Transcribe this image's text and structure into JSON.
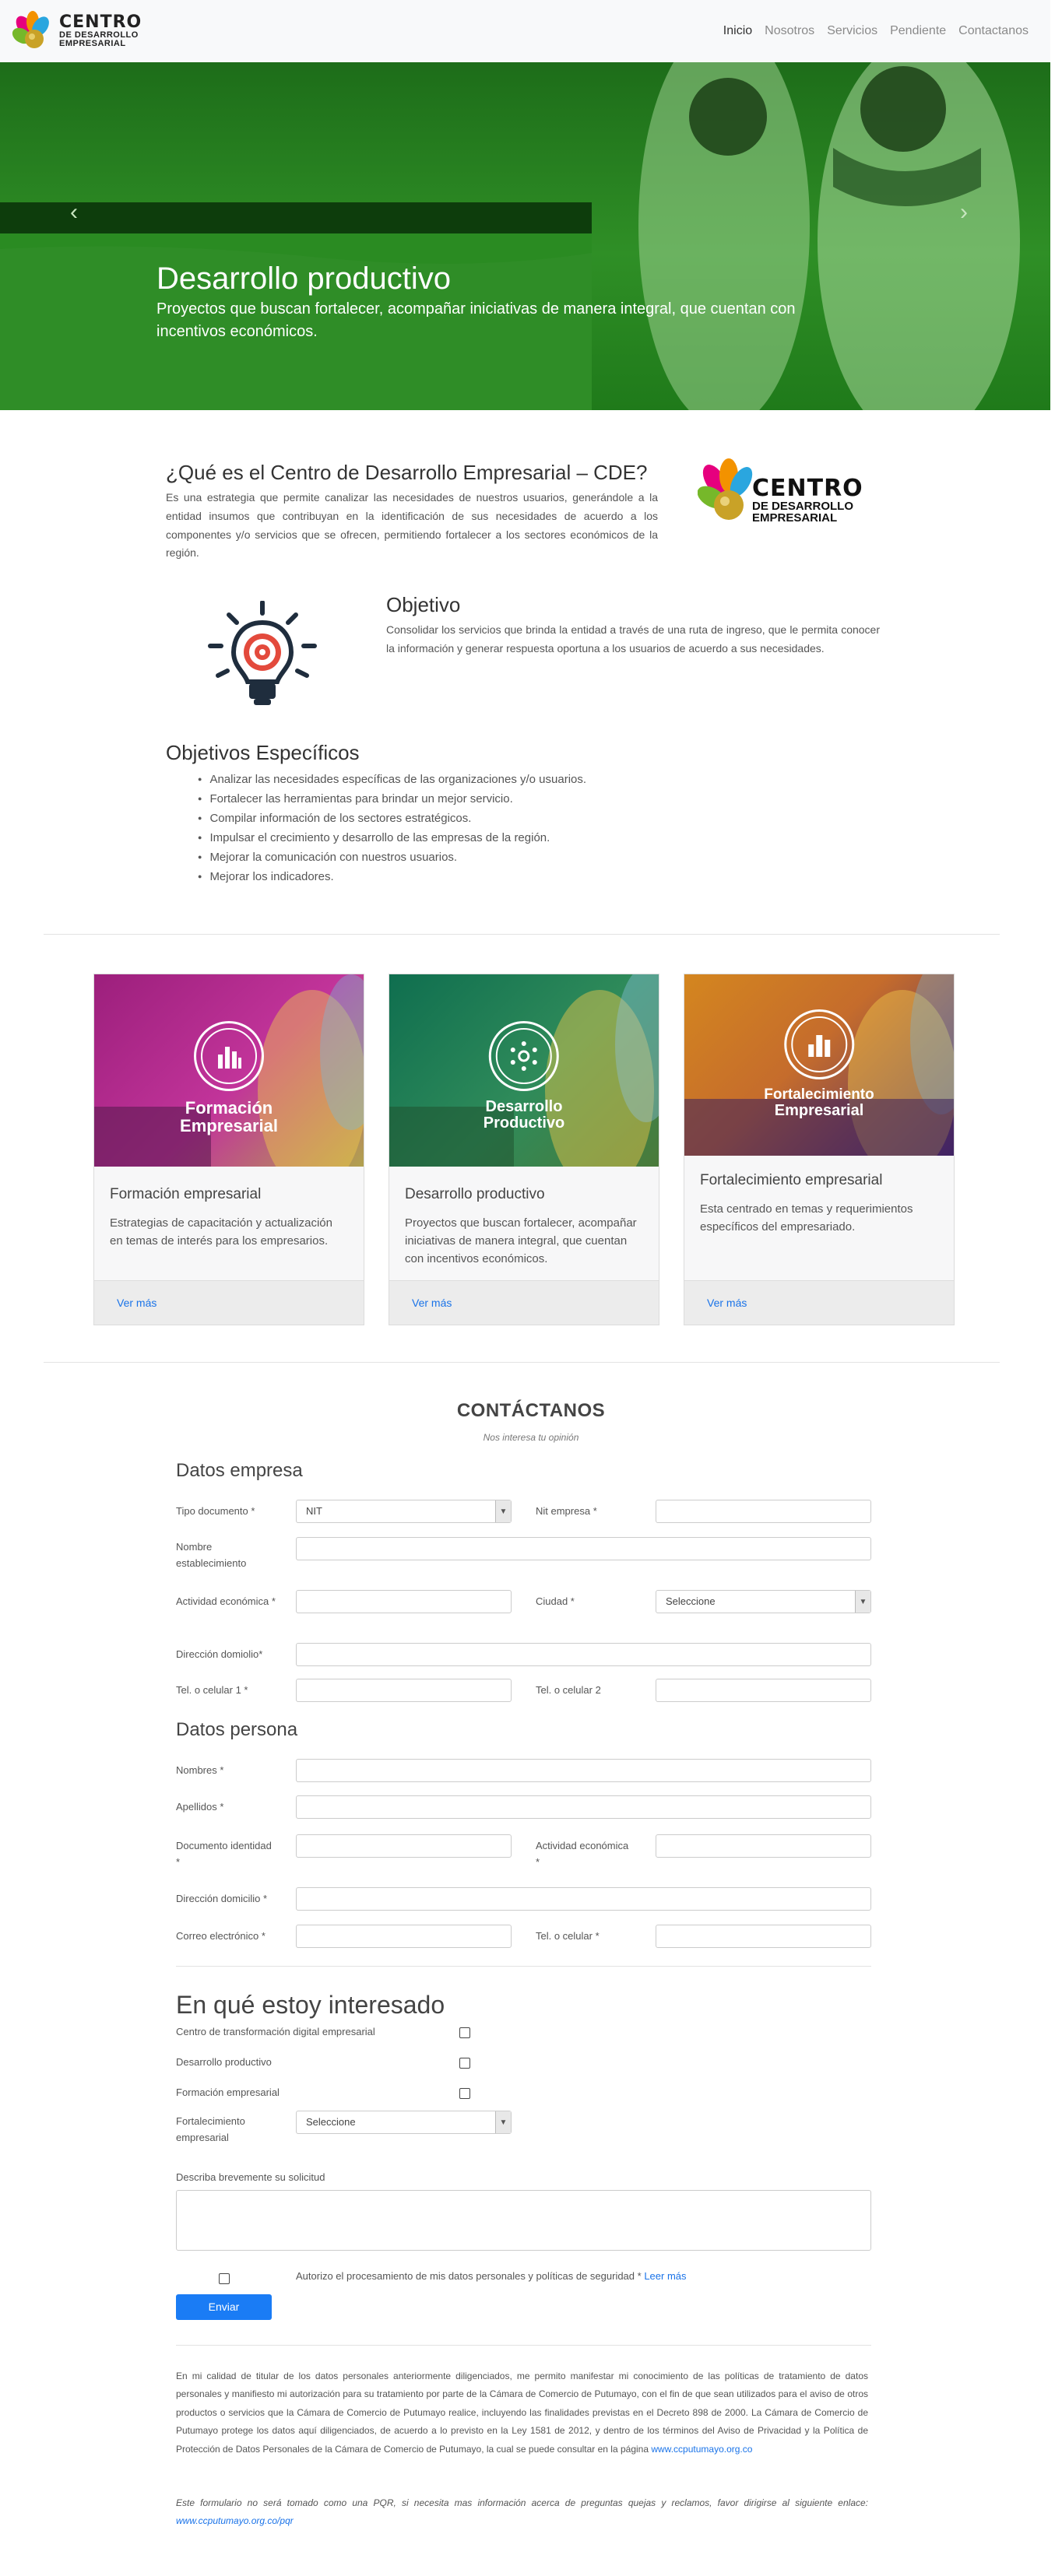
{
  "nav": {
    "logo": {
      "line1": "CENTRO",
      "line2": "DE DESARROLLO",
      "line3": "EMPRESARIAL"
    },
    "links": [
      "Inicio",
      "Nosotros",
      "Servicios",
      "Pendiente",
      "Contactanos"
    ]
  },
  "hero": {
    "title": "Desarrollo productivo",
    "text": "Proyectos que buscan fortalecer, acompañar iniciativas de manera integral, que cuentan con incentivos económicos.",
    "prev": "‹",
    "next": "›"
  },
  "about": {
    "title": "¿Qué es el Centro de Desarrollo Empresarial – CDE?",
    "text": "Es una estrategia que permite canalizar las necesidades de nuestros usuarios, generándole a la entidad insumos que contribuyan en la identificación de sus necesidades de acuerdo a los componentes y/o servicios que se ofrecen, permitiendo fortalecer a los sectores económicos de la región."
  },
  "objective": {
    "title": "Objetivo",
    "text": "Consolidar los servicios que brinda la entidad a través de una ruta de ingreso, que le permita conocer la información y generar respuesta oportuna a los usuarios de acuerdo a sus necesidades."
  },
  "specific": {
    "title": "Objetivos Específicos",
    "items": [
      "Analizar las necesidades específicas de las organizaciones y/o usuarios.",
      "Fortalecer las herramientas para brindar un mejor servicio.",
      "Compilar información de los sectores estratégicos.",
      "Impulsar el crecimiento y desarrollo de las empresas de la región.",
      "Mejorar la comunicación con nuestros usuarios.",
      "Mejorar los indicadores."
    ]
  },
  "cards": [
    {
      "badge1": "Formación",
      "badge2": "Empresarial",
      "title": "Formación empresarial",
      "text": "Estrategias de capacitación y actualización en temas de interés para los empresarios.",
      "link": "Ver más"
    },
    {
      "badge1": "Desarrollo",
      "badge2": "Productivo",
      "title": "Desarrollo productivo",
      "text": "Proyectos que buscan fortalecer, acompañar iniciativas de manera integral, que cuentan con incentivos económicos.",
      "link": "Ver más"
    },
    {
      "badge1": "Fortalecimiento",
      "badge2": "Empresarial",
      "title": "Fortalecimiento empresarial",
      "text": "Esta centrado en temas y requerimientos específicos del empresariado.",
      "link": "Ver más"
    }
  ],
  "contact": {
    "title": "CONTÁCTANOS",
    "subtitle": "Nos interesa tu opinión",
    "company_title": "Datos empresa",
    "tipo_doc_label": "Tipo documento *",
    "tipo_doc_value": "NIT",
    "nit_label": "Nit empresa *",
    "nombre_label": "Nombre establecimiento",
    "actividad_label": "Actividad económica *",
    "ciudad_label": "Ciudad *",
    "ciudad_value": "Seleccione",
    "direccion_label": "Dirección domiolio*",
    "tel1_label": "Tel. o celular 1 *",
    "tel2_label": "Tel. o celular 2",
    "person_title": "Datos persona",
    "nombres_label": "Nombres *",
    "apellidos_label": "Apellidos *",
    "documento_label": "Documento identidad *",
    "actividad2_label": "Actividad económica *",
    "direccion2_label": "Dirección domicilio *",
    "correo_label": "Correo electrónico *",
    "tel_label": "Tel. o celular *",
    "interest_title": "En qué estoy interesado",
    "interest1": "Centro de transformación digital empresarial",
    "interest2": "Desarrollo productivo",
    "interest3": "Formación empresarial",
    "interest4": "Fortalecimiento empresarial",
    "interest4_value": "Seleccione",
    "describe_label": "Describa brevemente su solicitud",
    "consent": "Autorizo el procesamiento de mis datos personales y políticas de seguridad *",
    "consent_link": "Leer más",
    "submit": "Enviar",
    "legal1": "En mi calidad de titular de los datos personales anteriormente diligenciados, me permito manifestar mi conocimiento de las políticas de tratamiento de datos personales y manifiesto mi autorización para su tratamiento por parte de la Cámara de Comercio de Putumayo, con el fin de que sean utilizados para el aviso de otros productos o servicios que la Cámara de Comercio de Putumayo realice, incluyendo las finalidades previstas en el Decreto 898 de 2000. La Cámara de Comercio de Putumayo protege los datos aquí diligenciados, de acuerdo a lo previsto en la Ley 1581 de 2012, y dentro de los términos del Aviso de Privacidad y la Política de Protección de Datos Personales de la Cámara de Comercio de Putumayo, la cual se puede consultar en la página",
    "legal1_link": "www.ccputumayo.org.co",
    "legal2": "Este formulario no será tomado como una PQR, si necesita mas información acerca de preguntas quejas y reclamos, favor dirigirse al siguiente enlace:",
    "legal2_link": "www.ccputumayo.org.co/pqr"
  }
}
